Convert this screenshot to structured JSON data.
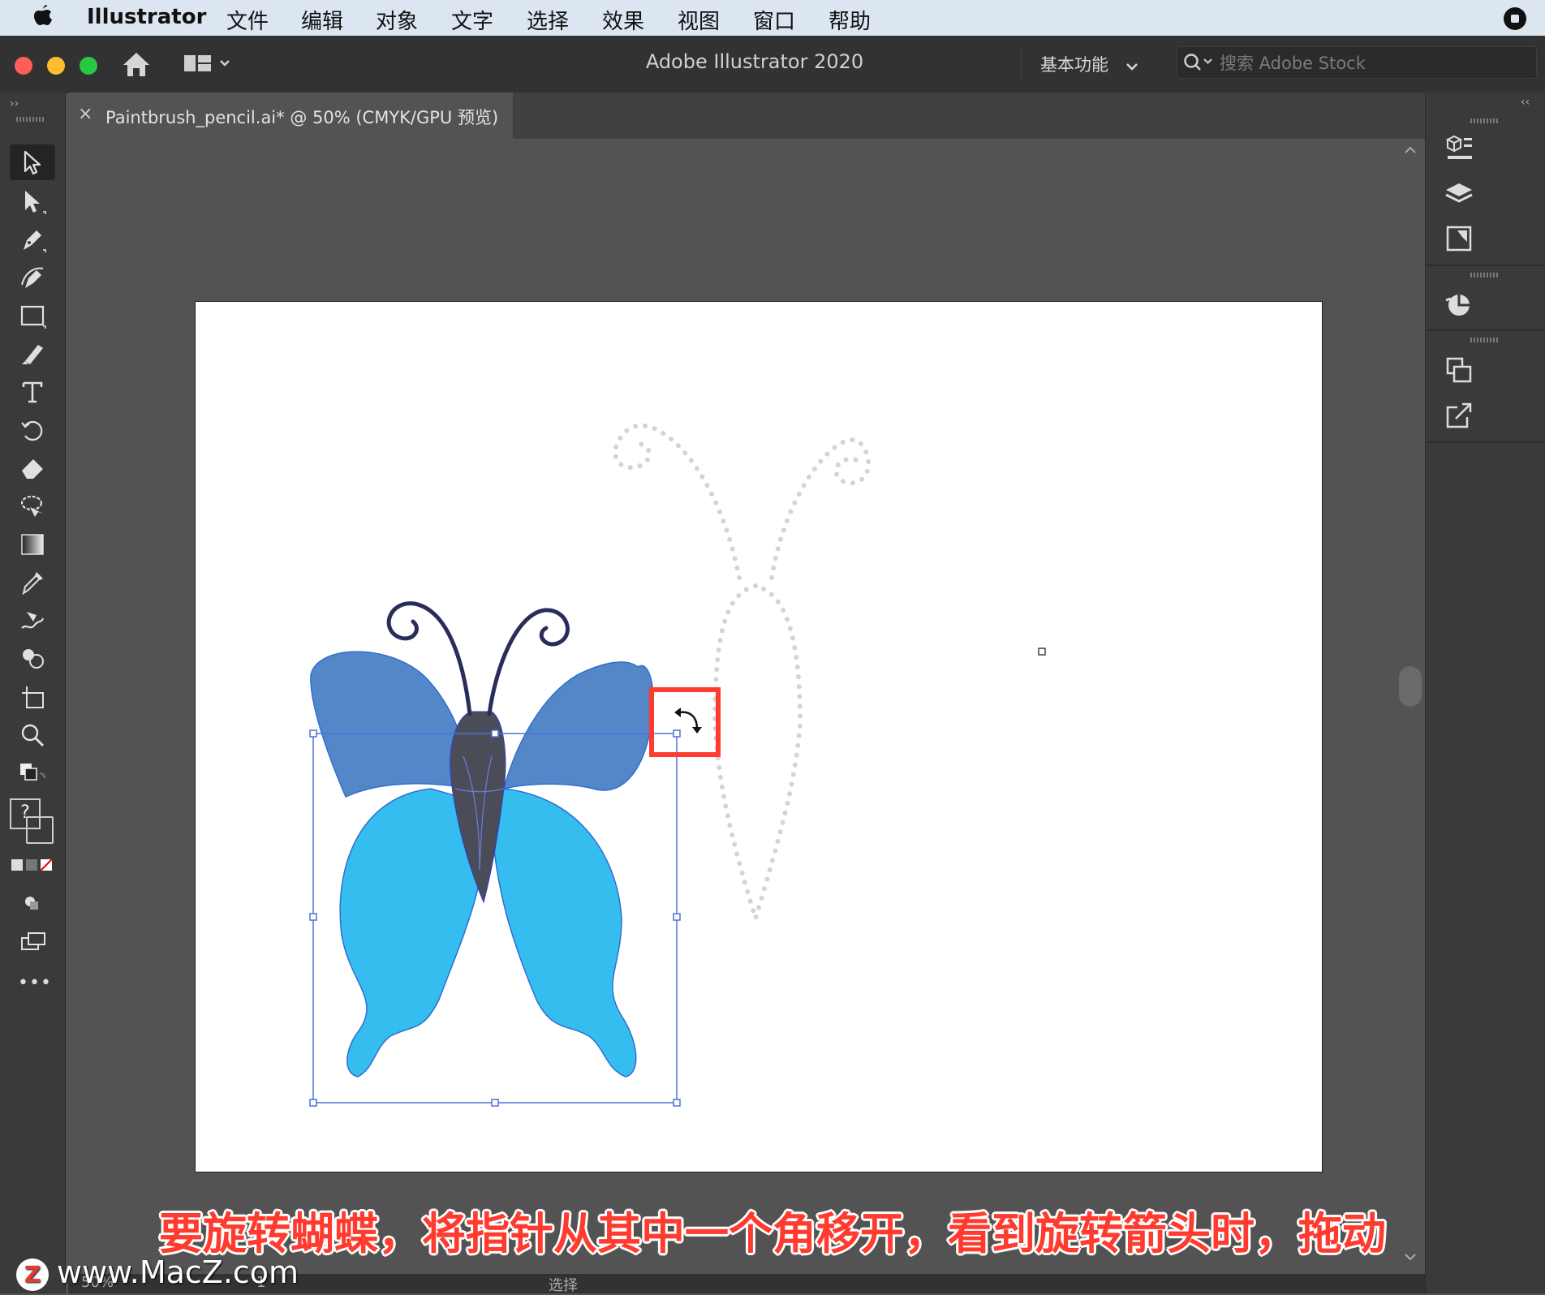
{
  "menubar": {
    "app_name": "Illustrator",
    "items": [
      "文件",
      "编辑",
      "对象",
      "文字",
      "选择",
      "效果",
      "视图",
      "窗口",
      "帮助"
    ]
  },
  "appbar": {
    "title": "Adobe Illustrator 2020",
    "workspace": "基本功能",
    "stock_placeholder": "搜索 Adobe Stock"
  },
  "document_tab": {
    "close_glyph": "×",
    "label": "Paintbrush_pencil.ai* @ 50% (CMYK/GPU 预览)"
  },
  "statusbar": {
    "zoom": "50%",
    "artboard_index": "1",
    "mode": "选择"
  },
  "toolbar": {
    "tools": [
      "selection-tool",
      "direct-selection-tool",
      "pen-tool",
      "curvature-tool",
      "rectangle-tool",
      "paintbrush-tool",
      "type-tool",
      "rotate-tool",
      "eraser-tool",
      "lasso-tool",
      "gradient-tool",
      "eyedropper-tool",
      "blend-tool",
      "shape-builder-tool",
      "artboard-tool",
      "zoom-tool"
    ],
    "fill_stroke_unknown": "?",
    "more_tools": "•••"
  },
  "right_panel": {
    "icons": [
      "libraries-icon",
      "layers-icon",
      "artboards-icon",
      "color-guide-icon",
      "transform-icon",
      "export-icon"
    ]
  },
  "caption": "要旋转蝴蝶，将指针从其中一个角移开，看到旋转箭头时，拖动",
  "watermark": {
    "logo_letter": "Z",
    "text": "www.MacZ.com"
  },
  "colors": {
    "upper_wing": "#5487c8",
    "lower_wing": "#35bdf0",
    "body": "#4a4d57",
    "selection": "#4d72d9",
    "highlight_box": "#ff3b2f"
  }
}
